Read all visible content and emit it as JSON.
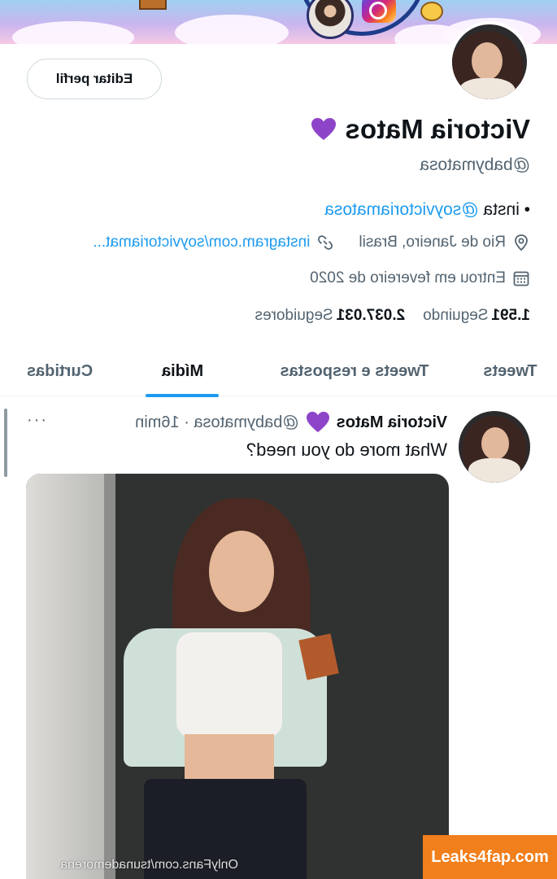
{
  "profile": {
    "edit_button": "Editar perfil",
    "display_name": "Victoria Matos",
    "handle": "@babymatosa",
    "bio_prefix": "• insta ",
    "bio_link": "@soyvictoriamatosa",
    "location": "Rio de Janeiro, Brasil",
    "website": "instagram.com/soyvictoriamat...",
    "joined": "Entrou em fevereiro de 2020",
    "following_count": "1.591",
    "following_label": "Seguindo",
    "followers_count": "2.037.031",
    "followers_label": "Seguidores"
  },
  "tabs": [
    "Tweets",
    "Tweets e respostas",
    "Mídia",
    "Curtidas"
  ],
  "active_tab": "Mídia",
  "tweet": {
    "name": "Victoria Matos",
    "meta": "@babymatosa · 16min",
    "more": "···",
    "text": "What more do you need?"
  },
  "watermark": {
    "site": "Leaks4fap.com",
    "overlay": "OnlyFans.com/tsunademorena"
  },
  "colors": {
    "accent": "#1d9bf0",
    "heart": "#8e44c8",
    "watermark_bg": "#f07f1c"
  }
}
